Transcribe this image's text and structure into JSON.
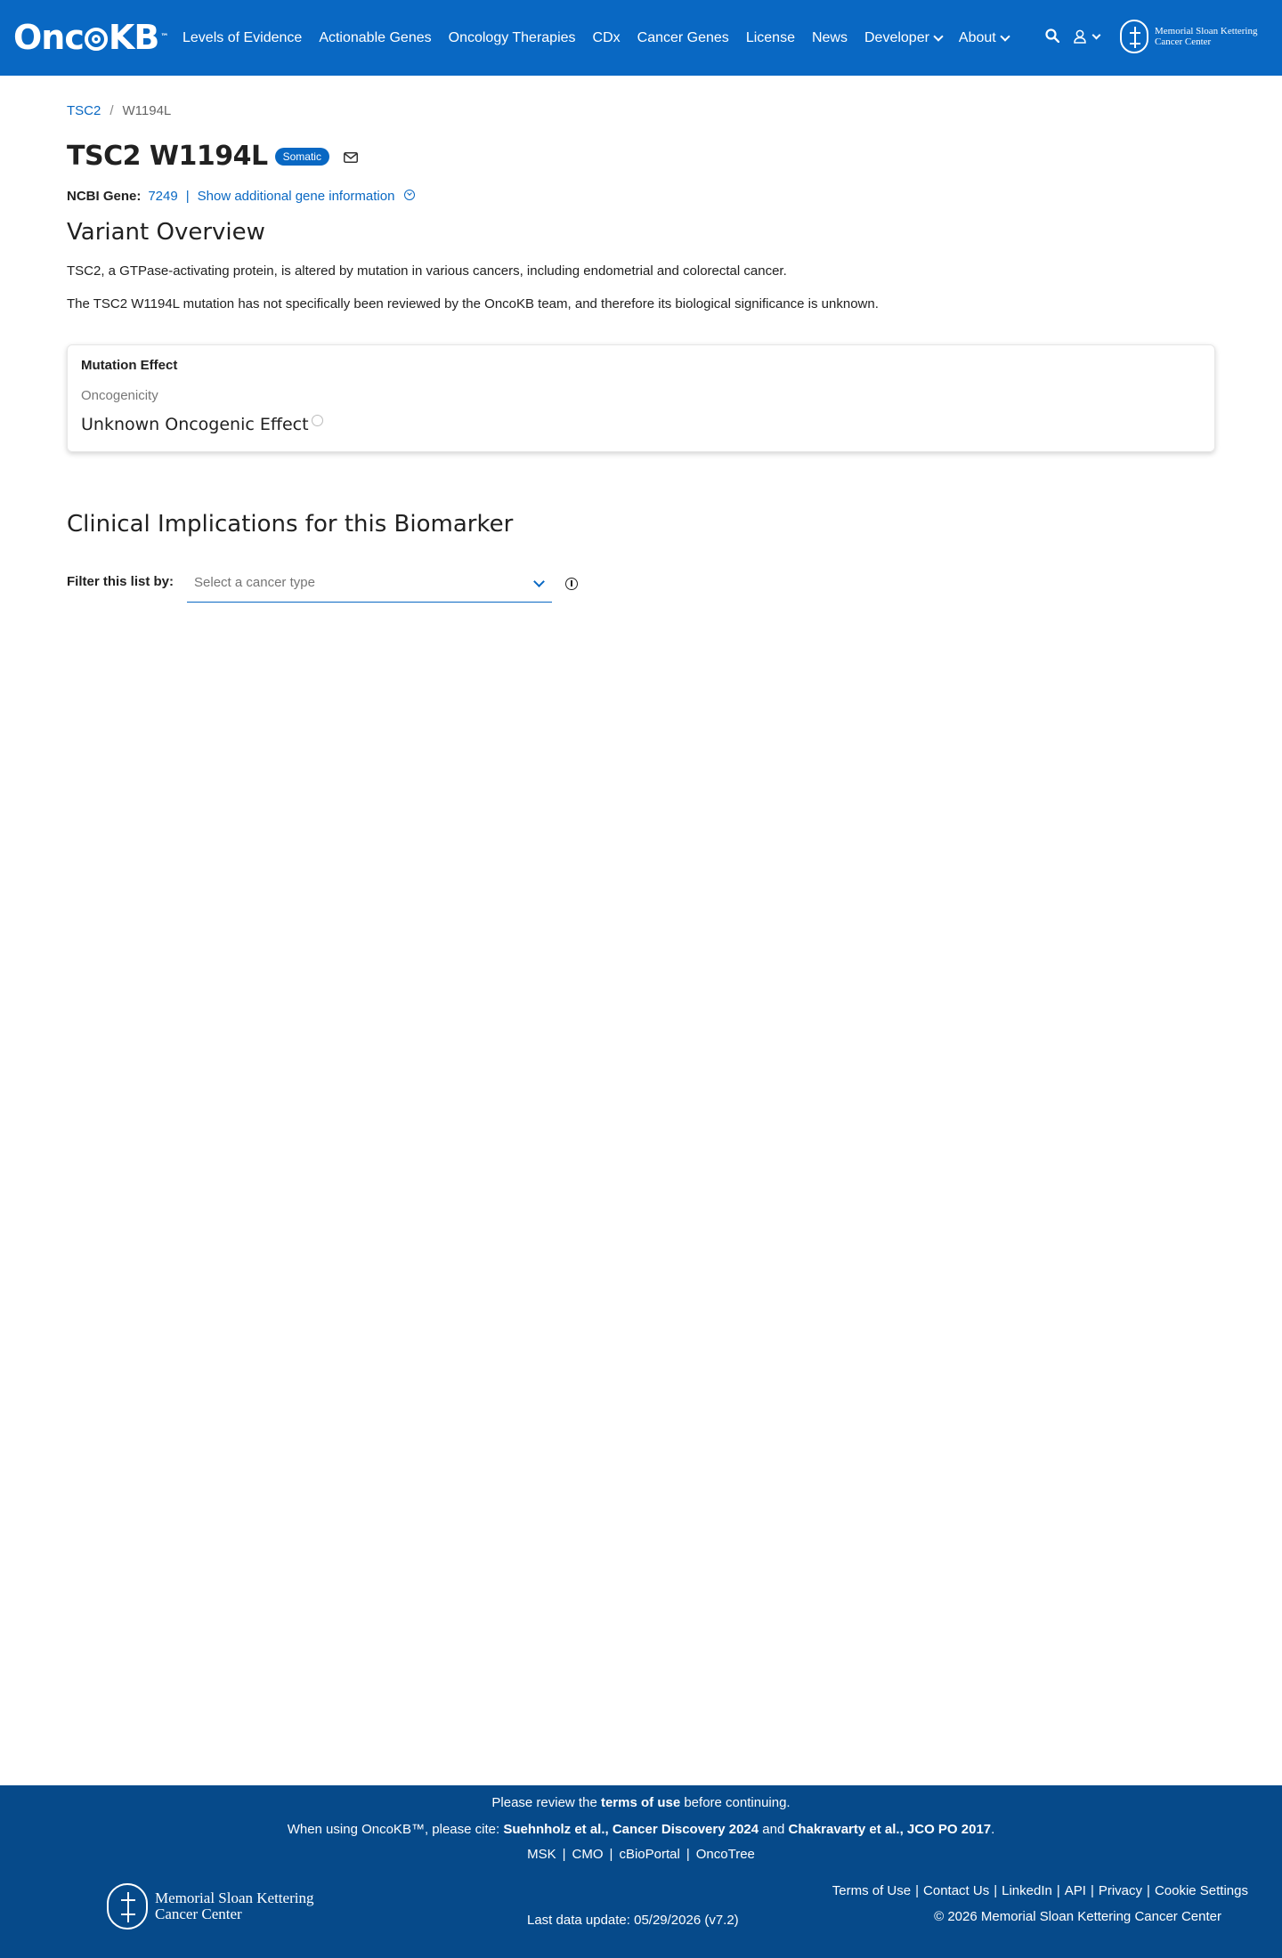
{
  "header": {
    "logo_text_left": "Onc",
    "logo_text_right": "KB",
    "logo_tm": "™",
    "nav": [
      {
        "label": "Levels of Evidence"
      },
      {
        "label": "Actionable Genes"
      },
      {
        "label": "Oncology Therapies"
      },
      {
        "label": "CDx"
      },
      {
        "label": "Cancer Genes"
      },
      {
        "label": "License"
      },
      {
        "label": "News"
      },
      {
        "label": "Developer"
      },
      {
        "label": "About"
      }
    ],
    "msk_line1": "Memorial Sloan Kettering",
    "msk_line2": "Cancer Center"
  },
  "breadcrumb": {
    "gene": "TSC2",
    "separator": "/",
    "variant": "W1194L"
  },
  "title": {
    "text": "TSC2 W1194L",
    "badge": "Somatic"
  },
  "gene_info": {
    "label": "NCBI Gene:",
    "id": "7249",
    "pipe": "|",
    "more": "Show additional gene information"
  },
  "overview": {
    "heading": "Variant Overview",
    "para1": "TSC2, a GTPase-activating protein, is altered by mutation in various cancers, including endometrial and colorectal cancer.",
    "para2": "The TSC2 W1194L mutation has not specifically been reviewed by the OncoKB team, and therefore its biological significance is unknown."
  },
  "mutation_card": {
    "title": "Mutation Effect",
    "sub": "Oncogenicity",
    "effect": "Unknown Oncogenic Effect"
  },
  "clinical": {
    "heading": "Clinical Implications for this Biomarker",
    "filter_label": "Filter this list by:",
    "select_placeholder": "Select a cancer type"
  },
  "footer": {
    "l1_pre": "Please review the ",
    "l1_link": "terms of use",
    "l1_post": " before continuing.",
    "l2_pre": "When using OncoKB™, please cite: ",
    "l2_cite1": "Suehnholz et al., Cancer Discovery 2024",
    "l2_and": " and ",
    "l2_cite2": "Chakravarty et al., JCO PO 2017",
    "l2_post": ".",
    "links": [
      "MSK",
      "CMO",
      "cBioPortal",
      "OncoTree"
    ],
    "msk_line1": "Memorial Sloan Kettering",
    "msk_line2": "Cancer Center",
    "last_update": "Last data update: 05/29/2026 (v7.2)",
    "right_links": [
      "Terms of Use",
      "Contact Us",
      "LinkedIn",
      "API",
      "Privacy",
      "Cookie Settings"
    ],
    "separator": "|",
    "copyright": "© 2026 Memorial Sloan Kettering Cancer Center"
  },
  "colors": {
    "brand": "#0968c3",
    "footer": "#064a8a"
  }
}
